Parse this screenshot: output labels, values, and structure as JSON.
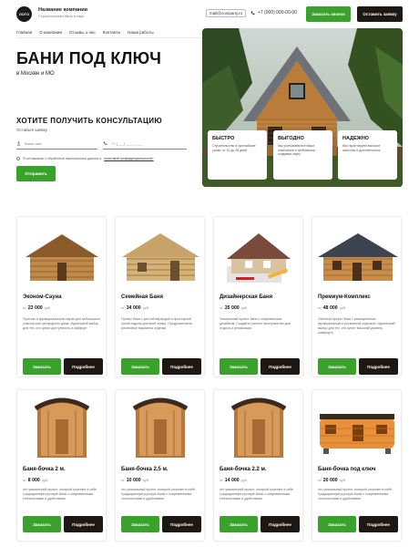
{
  "header": {
    "logo": "ЛОГО",
    "company_name": "Название компании",
    "company_sub": "Строительство бань и саун",
    "email": "mail@company.ru",
    "phone": "+7 (000) 000-00-00",
    "call_button": "Заказать звонок",
    "order_button": "Оставить заявку"
  },
  "nav": [
    "Главная",
    "О компании",
    "Отзывы о нас",
    "Контакты",
    "Наши работы"
  ],
  "hero": {
    "title": "БАНИ ПОД КЛЮЧ",
    "subtitle": "в Москве и МО",
    "consult_title": "ХОТИТЕ ПОЛУЧИТЬ КОНСУЛЬТАЦИЮ",
    "consult_sub": "Оставьте заявку",
    "name_placeholder": "Ваше имя",
    "phone_placeholder": "+7 (___) ___-__-__",
    "consent_text": "Я соглашаюсь с обработкой персональных данных и",
    "consent_link": "политикой конфиденциальности*",
    "send_button": "Отправить"
  },
  "features": [
    {
      "title": "БЫСТРО",
      "desc": "Строительство в кратчайшие сроки: от 10 до 28 дней"
    },
    {
      "title": "ВЫГОДНО",
      "desc": "Мы учитываем все ваши пожелания и требования, создавая сауну"
    },
    {
      "title": "НАДЕЖНО",
      "desc": "Мы гарантируем высокое качество и долговечность"
    }
  ],
  "currency": "руб.",
  "price_prefix": "от",
  "card_order_label": "Заказать",
  "card_details_label": "Подробнее",
  "products": [
    {
      "title": "Эконом-Сауна",
      "price": "23 000",
      "desc": "Простая и функциональная сауна для небольшого участка или загородного дома. Идеальный выбор для тех, кто ценит доступность и комфорт",
      "image": "small-log-sauna-icon"
    },
    {
      "title": "Семейная Баня",
      "price": "34 000",
      "desc": "Проект бани с уютной верандой и просторной зоной отдыха для всей семьи. Предусмотрены различные варианты отделки",
      "image": "log-bath-house-icon"
    },
    {
      "title": "Дизайнерская Баня",
      "price": "35 000",
      "desc": "Уникальный проект бани с современным дизайном. Создайте уютное пространство для отдыха и релаксации",
      "image": "house-blueprint-icon"
    },
    {
      "title": "Премиум-Комплекс",
      "price": "48 000",
      "desc": "Элитный проект бани с расширенным функционалом и роскошной отделкой. Идеальный выбор для тех, кто ценит высокий уровень комфорта",
      "image": "large-log-house-icon"
    },
    {
      "title": "Баня-бочка 2 м.",
      "price": "8 000",
      "desc": "это уникальный проект, который сочетает в себе традиционную русскую баню с современными технологиями и удобствами",
      "image": "barrel-sauna-icon"
    },
    {
      "title": "Баня-бочка 2.5 м.",
      "price": "10 000",
      "desc": "это уникальный проект, который сочетает в себе традиционную русскую баню с современными технологиями и удобствами",
      "image": "barrel-sauna-icon"
    },
    {
      "title": "Баня-бочка 2.2 м.",
      "price": "14 000",
      "desc": "это уникальный проект, который сочетает в себе традиционную русскую баню с современными технологиями и удобствами",
      "image": "barrel-sauna-icon"
    },
    {
      "title": "Баня-бочка под ключ",
      "price": "20 000",
      "desc": "это уникальный проект, который сочетает в себе традиционную русскую баню с современными технологиями и удобствами",
      "image": "long-barrel-sauna-icon"
    }
  ],
  "colors": {
    "accent": "#3aa12c",
    "dark": "#1e1814"
  }
}
